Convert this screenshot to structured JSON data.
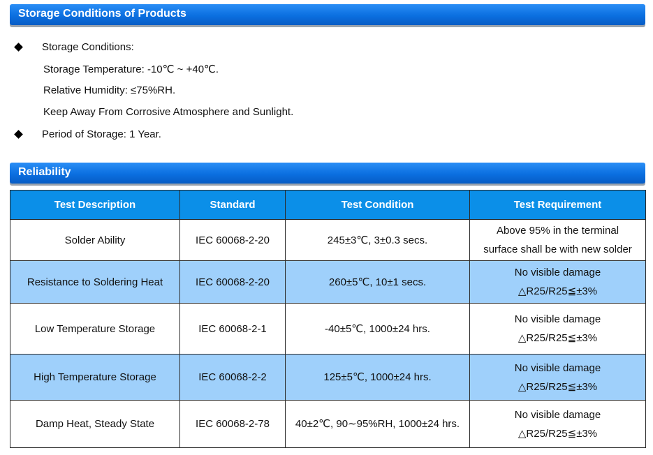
{
  "storage": {
    "title": "Storage Conditions of Products",
    "bullet1": "Storage Conditions:",
    "lines": [
      "Storage Temperature: -10℃ ~ +40℃.",
      "Relative Humidity: ≤75%RH.",
      "Keep Away From Corrosive Atmosphere and Sunlight."
    ],
    "bullet2": "Period of Storage: 1 Year."
  },
  "reliability": {
    "title": "Reliability",
    "headers": [
      "Test Description",
      "Standard",
      "Test Condition",
      "Test Requirement"
    ],
    "rows": [
      {
        "description": "Solder Ability",
        "standard": "IEC 60068-2-20",
        "condition": "245±3℃, 3±0.3 secs.",
        "requirement": [
          "Above 95% in the terminal",
          "surface shall be with new solder"
        ]
      },
      {
        "description": "Resistance to Soldering Heat",
        "standard": "IEC 60068-2-20",
        "condition": "260±5℃, 10±1 secs.",
        "requirement": [
          "No visible damage",
          "△R25/R25≦±3%"
        ]
      },
      {
        "description": "Low Temperature Storage",
        "standard": "IEC 60068-2-1",
        "condition": "-40±5℃, 1000±24 hrs.",
        "requirement": [
          "No visible damage",
          "△R25/R25≦±3%"
        ]
      },
      {
        "description": "High Temperature Storage",
        "standard": "IEC 60068-2-2",
        "condition": "125±5℃, 1000±24 hrs.",
        "requirement": [
          "No visible damage",
          "△R25/R25≦±3%"
        ]
      },
      {
        "description": "Damp Heat, Steady State",
        "standard": "IEC 60068-2-78",
        "condition": "40±2℃, 90∼95%RH, 1000±24 hrs.",
        "requirement": [
          "No visible damage",
          "△R25/R25≦±3%"
        ]
      }
    ]
  }
}
